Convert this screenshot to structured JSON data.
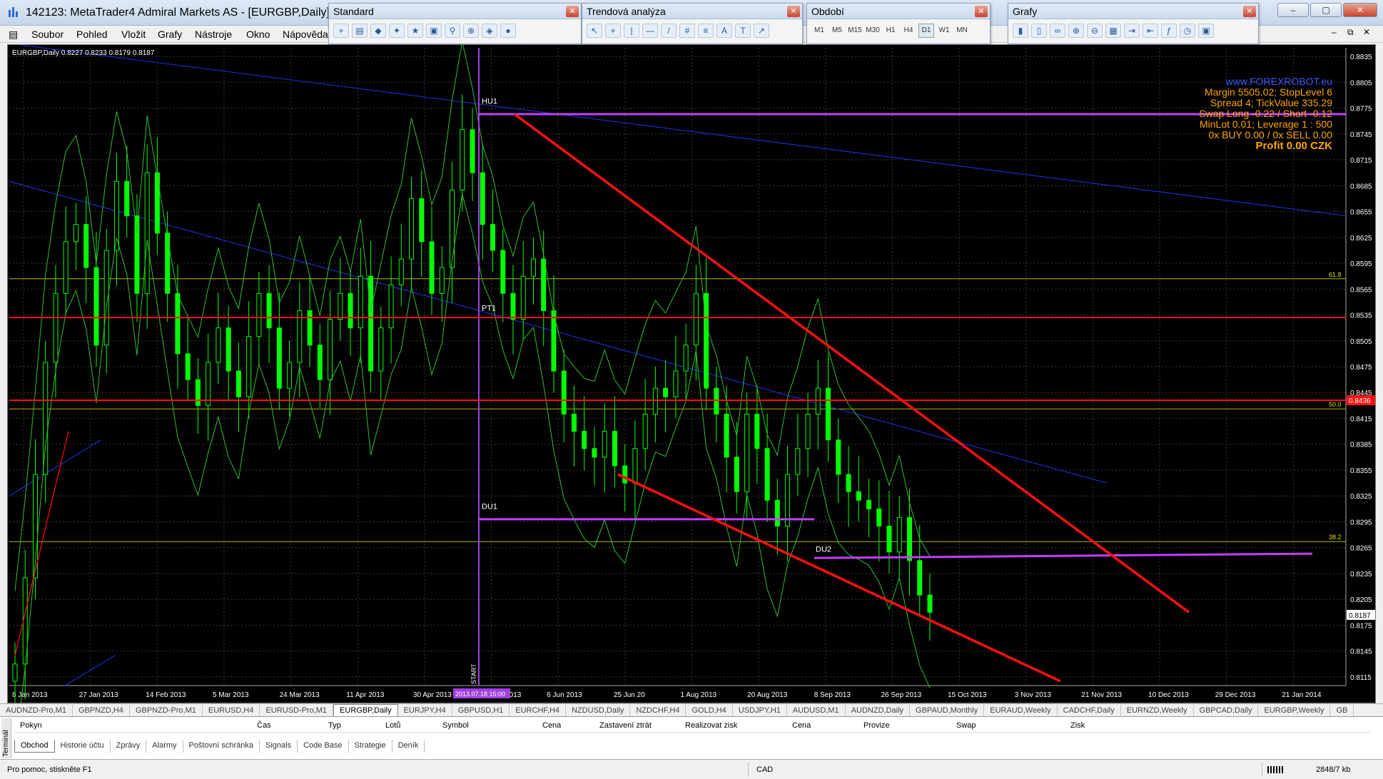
{
  "window": {
    "title": "142123: MetaTrader4 Admiral Markets AS - [EURGBP,Daily]"
  },
  "menu": [
    "Soubor",
    "Pohled",
    "Vložit",
    "Grafy",
    "Nástroje",
    "Okno",
    "Nápověda"
  ],
  "toolbars": {
    "standard": {
      "title": "Standard"
    },
    "trend": {
      "title": "Trendová analýza",
      "tools": [
        "A"
      ]
    },
    "periods": {
      "title": "Období",
      "items": [
        "M1",
        "M5",
        "M15",
        "M30",
        "H1",
        "H4",
        "D1",
        "W1",
        "MN"
      ]
    },
    "charts": {
      "title": "Grafy"
    }
  },
  "chart": {
    "header": "EURGBP,Daily  0.8227 0.8233 0.8179 0.8187",
    "info": {
      "site": "www.FOREXROBOT.eu",
      "line1": "Margin 5505.02; StopLevel 6",
      "line2": "Spread 4; TickValue 335.29",
      "line3": "Swap Long -0.22 / Short -0.12",
      "line4": "MinLot 0.01; Leverage 1 : 500",
      "line5": "0x BUY 0.00 / 0x SELL 0.00",
      "profit": "Profit 0.00 CZK"
    }
  },
  "chart_data": {
    "type": "candlestick",
    "symbol": "EURGBP",
    "timeframe": "Daily",
    "ohlc_last": {
      "open": 0.8227,
      "high": 0.8233,
      "low": 0.8179,
      "close": 0.8187
    },
    "y_ticks": [
      "0.8835",
      "0.8805",
      "0.8775",
      "0.8745",
      "0.8715",
      "0.8685",
      "0.8655",
      "0.8625",
      "0.8595",
      "0.8565",
      "0.8535",
      "0.8505",
      "0.8475",
      "0.8445",
      "0.8415",
      "0.8385",
      "0.8355",
      "0.8325",
      "0.8295",
      "0.8265",
      "0.8235",
      "0.8205",
      "0.8175",
      "0.8145",
      "0.8115"
    ],
    "ylim": [
      0.8105,
      0.8845
    ],
    "x_ticks": [
      "8 Jan 2013",
      "27 Jan 2013",
      "14 Feb 2013",
      "5 Mar 2013",
      "24 Mar 2013",
      "11 Apr 2013",
      "30 Apr 2013",
      "19 May 2013",
      "6 Jun 2013",
      "25 Jun 20",
      "1 Aug 2013",
      "20 Aug 2013",
      "8 Sep 2013",
      "26 Sep 2013",
      "15 Oct 2013",
      "3 Nov 2013",
      "21 Nov 2013",
      "10 Dec 2013",
      "29 Dec 2013",
      "21 Jan 2014"
    ],
    "x_highlight": "2013.07.18 15:00",
    "current_price": "0.8187",
    "red_level_label": "0.8436",
    "fib_levels": [
      {
        "label": "61.8",
        "price": 0.8577
      },
      {
        "label": "50.0",
        "price": 0.8426
      },
      {
        "label": "38.2",
        "price": 0.8272
      }
    ],
    "red_levels": [
      0.8532,
      0.8436
    ],
    "labels": [
      {
        "text": "HU1",
        "price": 0.878
      },
      {
        "text": "PT1",
        "price": 0.8535
      },
      {
        "text": "DU1",
        "price": 0.8305
      },
      {
        "text": "DU2",
        "price": 0.8255
      },
      {
        "text": "START",
        "price": 0.812
      }
    ],
    "purple_levels": [
      {
        "name": "HU1",
        "price": 0.8768
      },
      {
        "name": "DU1",
        "price": 0.8298
      },
      {
        "name": "DU2",
        "price": 0.8253
      }
    ],
    "close_series": [
      0.813,
      0.823,
      0.835,
      0.848,
      0.856,
      0.862,
      0.864,
      0.859,
      0.85,
      0.861,
      0.869,
      0.865,
      0.856,
      0.87,
      0.863,
      0.856,
      0.849,
      0.846,
      0.843,
      0.848,
      0.852,
      0.847,
      0.844,
      0.851,
      0.856,
      0.852,
      0.845,
      0.848,
      0.854,
      0.85,
      0.846,
      0.853,
      0.856,
      0.852,
      0.858,
      0.847,
      0.852,
      0.857,
      0.86,
      0.867,
      0.862,
      0.856,
      0.859,
      0.868,
      0.875,
      0.87,
      0.864,
      0.861,
      0.856,
      0.853,
      0.858,
      0.86,
      0.854,
      0.847,
      0.842,
      0.84,
      0.838,
      0.837,
      0.84,
      0.836,
      0.834,
      0.838,
      0.842,
      0.845,
      0.844,
      0.847,
      0.85,
      0.856,
      0.845,
      0.842,
      0.837,
      0.833,
      0.842,
      0.838,
      0.832,
      0.829,
      0.835,
      0.838,
      0.842,
      0.845,
      0.839,
      0.835,
      0.833,
      0.832,
      0.831,
      0.829,
      0.826,
      0.83,
      0.825,
      0.821,
      0.819
    ]
  },
  "symbol_tabs": [
    "AUDNZD-Pro,M1",
    "GBPNZD,H4",
    "GBPNZD-Pro,M1",
    "EURUSD,H4",
    "EURUSD-Pro,M1",
    "EURGBP,Daily",
    "EURJPY,H4",
    "GBPUSD,H1",
    "EURCHF,H4",
    "NZDUSD,Daily",
    "NZDCHF,H4",
    "GOLD,H4",
    "USDJPY,H1",
    "AUDUSD,M1",
    "AUDNZD,Daily",
    "GBPAUD,Monthly",
    "EURAUD,Weekly",
    "CADCHF,Daily",
    "EURNZD,Weekly",
    "GBPCAD,Daily",
    "EURGBP,Weekly",
    "GB"
  ],
  "active_symbol_tab": "EURGBP,Daily",
  "terminal": {
    "side_label": "Terminál",
    "columns": [
      "Pokyn",
      "Čas",
      "Typ",
      "Lotů",
      "Symbol",
      "Cena",
      "Zastavení ztrát",
      "Realizovat zisk",
      "Cena",
      "Provize",
      "Swap",
      "Zisk"
    ],
    "tabs": [
      "Obchod",
      "Historie účtu",
      "Zprávy",
      "Alarmy",
      "Poštovní schránka",
      "Signals",
      "Code Base",
      "Strategie",
      "Deník"
    ]
  },
  "status": {
    "help": "Pro pomoc, stiskněte F1",
    "profile": "CAD",
    "traffic": "2848/7 kb"
  }
}
